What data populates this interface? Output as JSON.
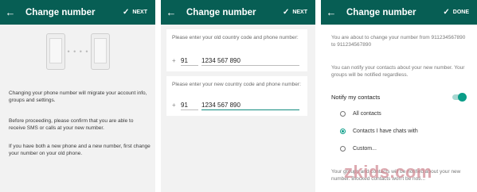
{
  "screens": [
    {
      "title": "Change number",
      "action": "NEXT",
      "paragraphs": [
        "Changing your phone number will migrate your account info, groups and settings.",
        "Before proceeding, please confirm that you are able to receive SMS or calls at your new number.",
        "If you have both a new phone and a new number, first change your number on your old phone."
      ]
    },
    {
      "title": "Change number",
      "action": "NEXT",
      "old_label": "Please enter your old country code and phone number:",
      "old_cc": "91",
      "old_number": "1234 567 890",
      "new_label": "Please enter your new country code and phone number:",
      "new_cc": "91",
      "new_number": "1234 567 890"
    },
    {
      "title": "Change number",
      "action": "DONE",
      "intro": "You are about to change your number from 911234567890 to 911234567890",
      "notify_desc": "You can notify your contacts about your new number. Your groups will be notified regardless.",
      "notify_label": "Notify my contacts",
      "notify_on": true,
      "options": [
        "All contacts",
        "Contacts I have chats with",
        "Custom..."
      ],
      "selected_option": 1,
      "footer": "Your groups and contacts will be notified about your new number. Blocked contacts won't be noti..."
    }
  ],
  "watermark": "zkids.com",
  "colors": {
    "appbar": "#075e54",
    "accent": "#0a9d88"
  }
}
